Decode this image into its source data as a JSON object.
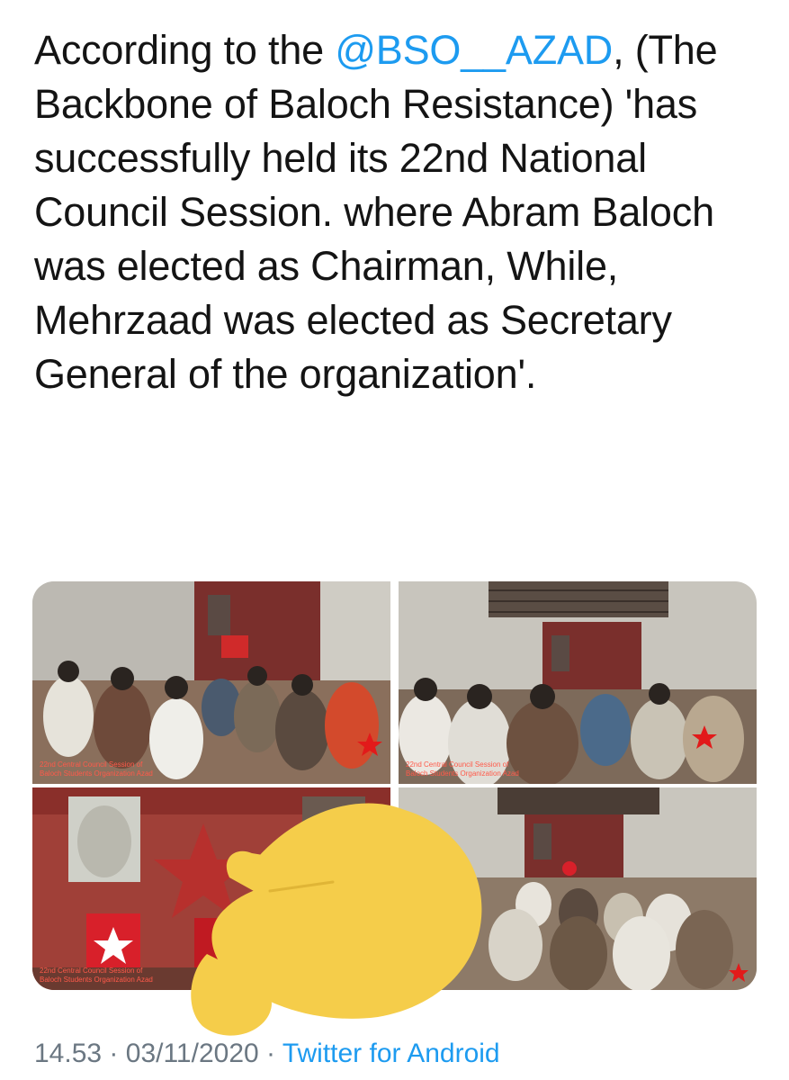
{
  "tweet": {
    "text_before_mention": "According to the ",
    "mention": "@BSO__AZAD",
    "text_after_mention": ", (The Backbone of Baloch Resistance) 'has successfully held its 22nd National Council Session. where Abram Baloch was elected as Chairman, While, Mehrzaad was elected as Secretary General of the organization'.",
    "time": "14.53",
    "separator1": "·",
    "date": "03/11/2020",
    "separator2": "·",
    "client": "Twitter for Android"
  },
  "photos": [
    {
      "caption_line1": "22nd Central Council Session of",
      "caption_line2": "Baloch Students Organization Azad"
    },
    {
      "caption_line1": "22nd Central Council Session of",
      "caption_line2": "Baloch Students Organization Azad"
    },
    {
      "caption_line1": "22nd Central Council Session of",
      "caption_line2": "Baloch Students Organization Azad"
    },
    {
      "caption_line1": "",
      "caption_line2": ""
    }
  ],
  "colors": {
    "mention": "#1d9bf0",
    "text": "#141414",
    "meta": "#6b7782",
    "annotation_hand": "#f5cd4a"
  },
  "icons": [
    "pointing-hand-emoji"
  ]
}
